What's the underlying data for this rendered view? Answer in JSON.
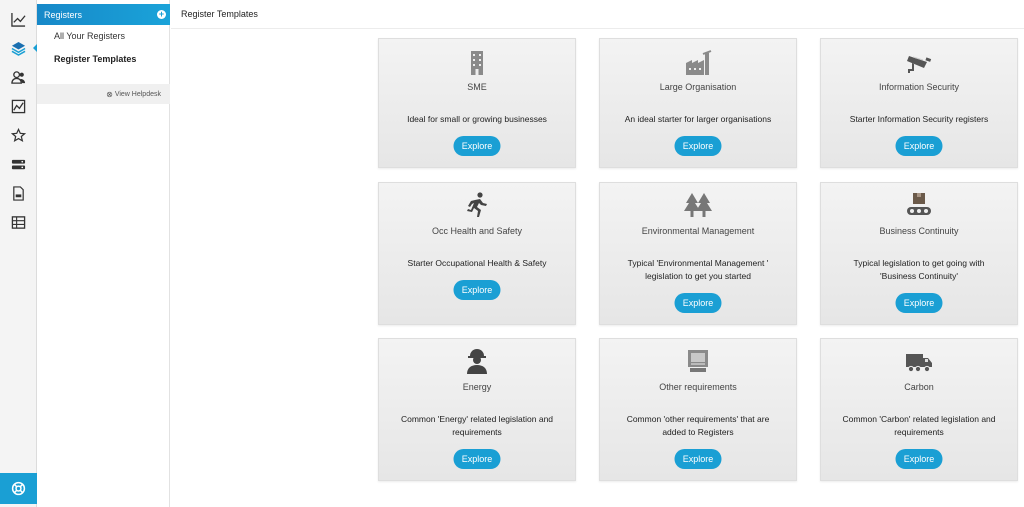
{
  "rail": {
    "items": [
      {
        "icon": "line-chart-icon"
      },
      {
        "icon": "layers-icon",
        "active": true
      },
      {
        "icon": "users-icon"
      },
      {
        "icon": "area-chart-icon"
      },
      {
        "icon": "star-icon"
      },
      {
        "icon": "server-icon"
      },
      {
        "icon": "document-icon"
      },
      {
        "icon": "table-icon"
      }
    ],
    "help_icon": "lifebuoy-icon",
    "accent": "#1a9fd4"
  },
  "sidebar": {
    "header": "Registers",
    "links": [
      "All Your Registers",
      "Register Templates"
    ],
    "helpdesk": "View Helpdesk"
  },
  "main": {
    "title": "Register Templates"
  },
  "cards": [
    {
      "icon": "building-icon",
      "name": "SME",
      "desc": "Ideal for small or growing businesses",
      "button": "Explore"
    },
    {
      "icon": "factory-icon",
      "name": "Large Organisation",
      "desc": "An ideal starter for larger organisations",
      "button": "Explore"
    },
    {
      "icon": "cctv-camera-icon",
      "name": "Information Security",
      "desc": "Starter Information Security registers",
      "button": "Explore"
    },
    {
      "icon": "running-person-icon",
      "name": "Occ Health and Safety",
      "desc": "Starter Occupational Health & Safety",
      "button": "Explore"
    },
    {
      "icon": "trees-icon",
      "name": "Environmental Management",
      "desc": "Typical 'Environmental Management ' legislation to get you started",
      "button": "Explore"
    },
    {
      "icon": "conveyor-box-icon",
      "name": "Business Continuity",
      "desc": "Typical legislation to get going with 'Business Continuity'",
      "button": "Explore"
    },
    {
      "icon": "worker-hardhat-icon",
      "name": "Energy",
      "desc": "Common 'Energy' related legislation and requirements",
      "button": "Explore"
    },
    {
      "icon": "monitor-icon",
      "name": "Other requirements",
      "desc": "Common 'other requirements' that are added to Registers",
      "button": "Explore"
    },
    {
      "icon": "truck-icon",
      "name": "Carbon",
      "desc": "Common 'Carbon' related legislation and requirements",
      "button": "Explore"
    }
  ]
}
